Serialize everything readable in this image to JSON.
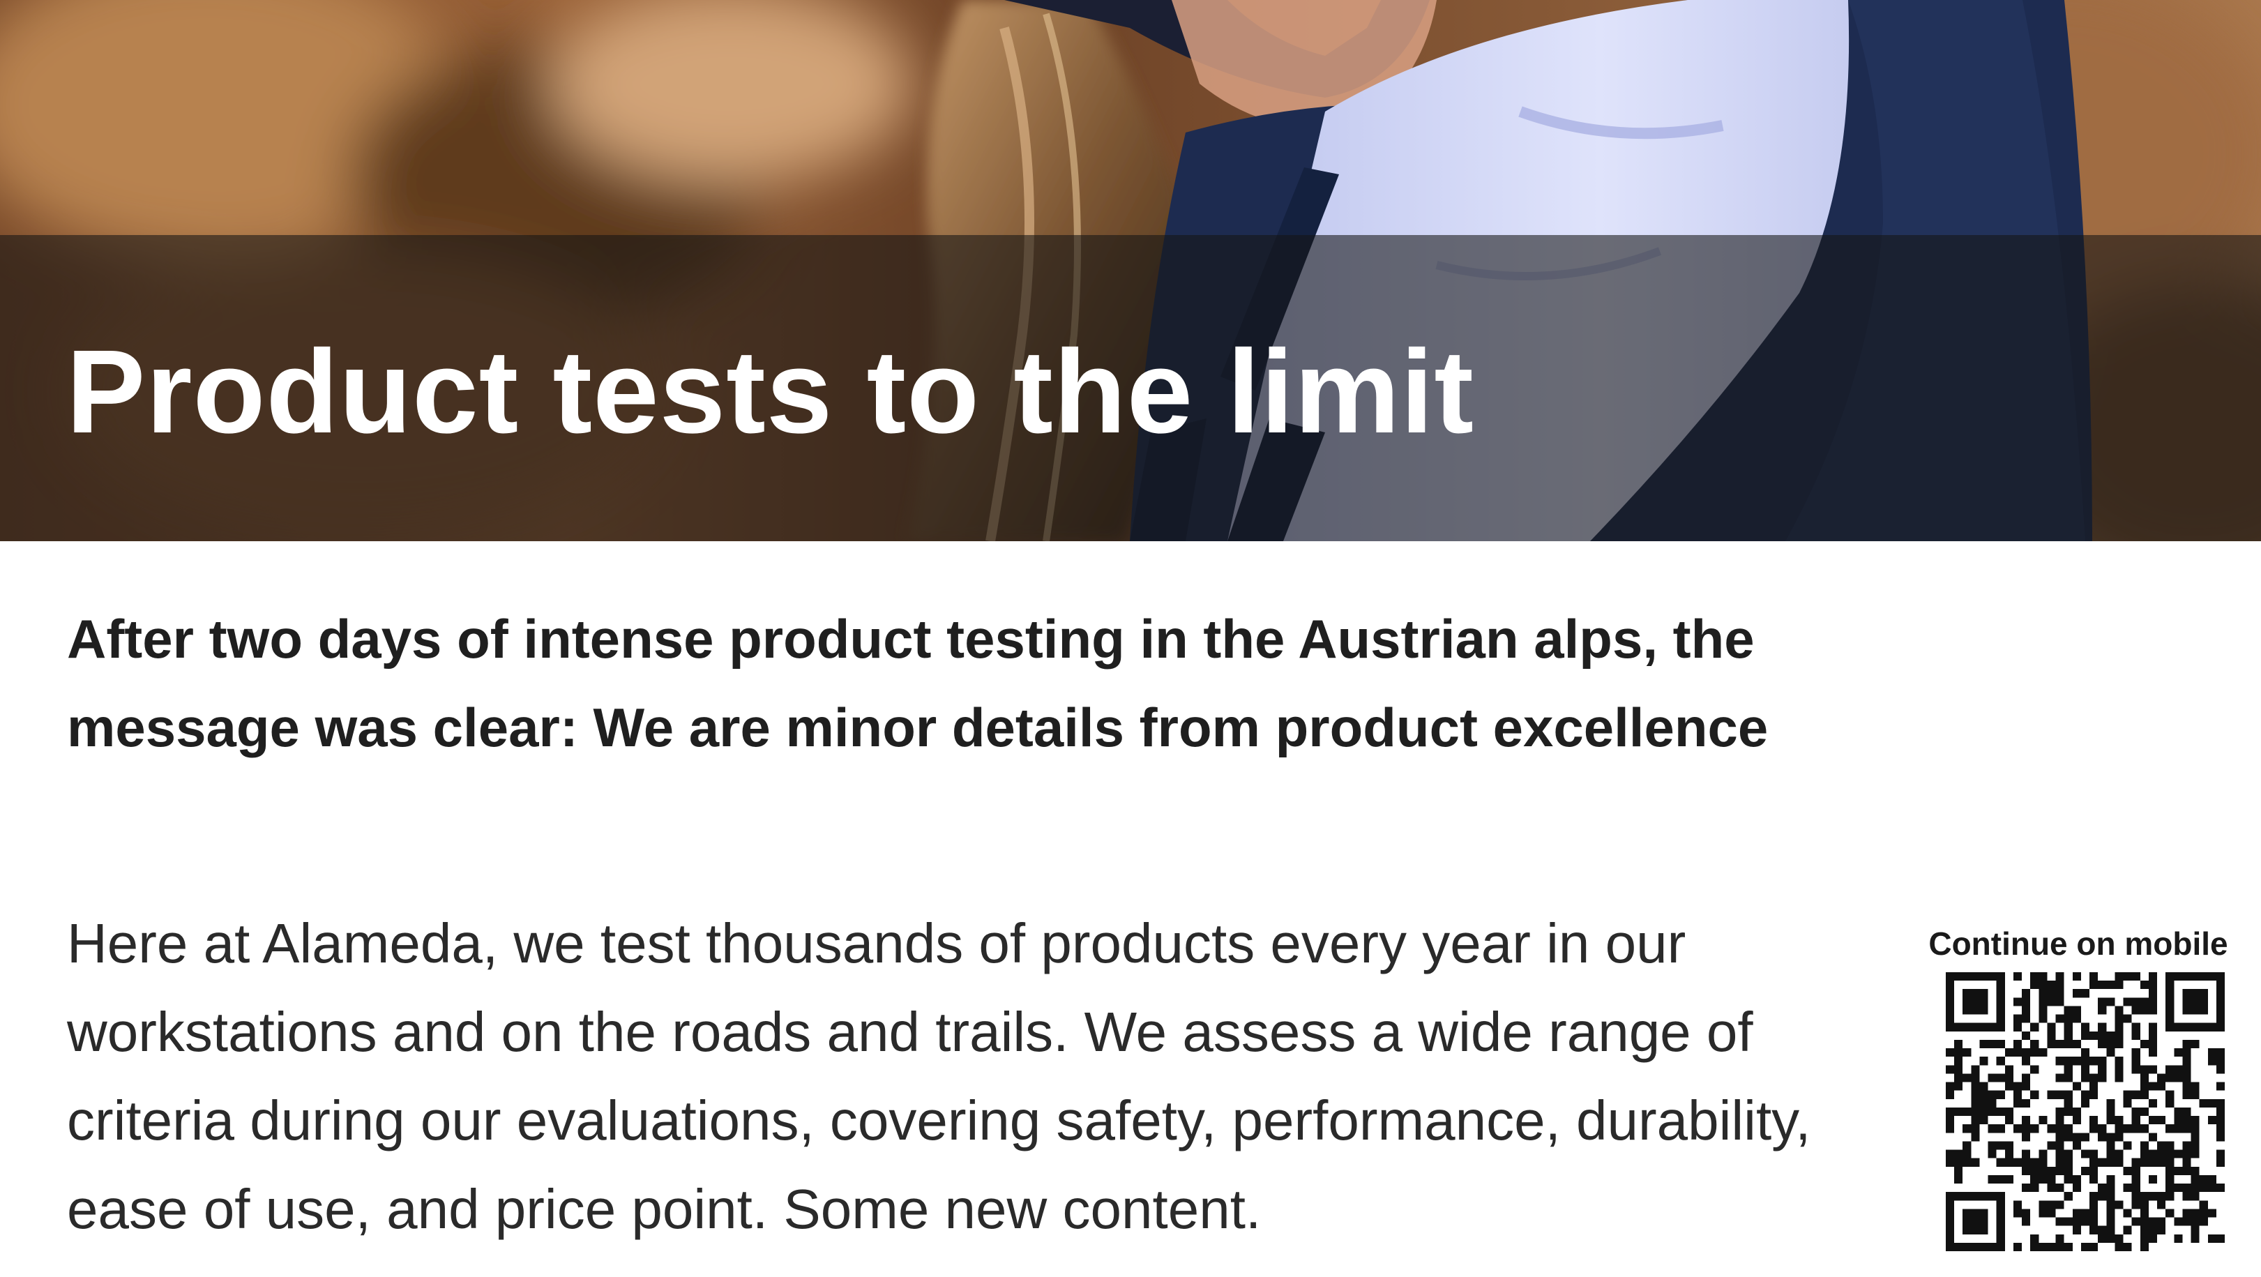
{
  "hero": {
    "title": "Product tests to the limit",
    "image_icon": "hero-photo-rider"
  },
  "article": {
    "lead": "After two days of intense product testing in the Austrian alps, the message was clear: We are minor details from product excellence",
    "body": "Here at Alameda, we test thousands of products every year in our workstations and on the roads and trails. We assess a wide range of criteria during our evaluations, covering safety, performance, durability, ease of use, and price point. Some new content."
  },
  "qr": {
    "label": "Continue on mobile",
    "icon": "qr-code-icon"
  },
  "colors": {
    "overlay": "#141414",
    "title": "#ffffff",
    "jersey_light": "#cfd4f3",
    "jersey_dark": "#1b2a4f",
    "background_brown": "#8a5a34"
  }
}
